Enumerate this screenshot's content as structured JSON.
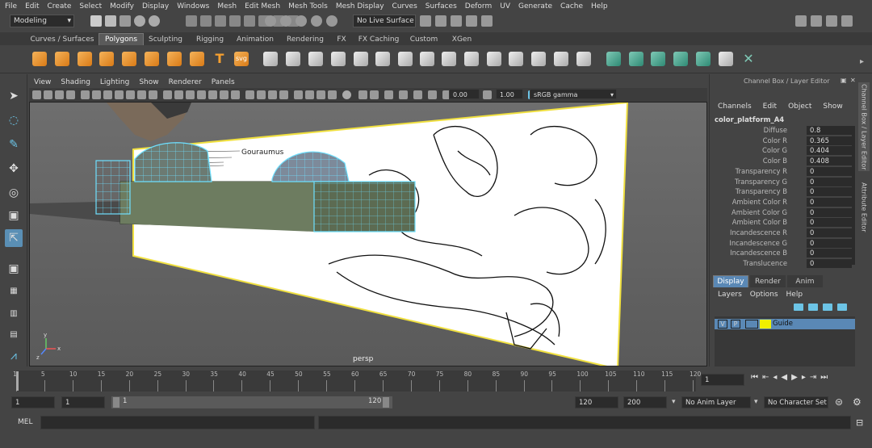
{
  "menubar": [
    "File",
    "Edit",
    "Create",
    "Select",
    "Modify",
    "Display",
    "Windows",
    "Mesh",
    "Edit Mesh",
    "Mesh Tools",
    "Mesh Display",
    "Curves",
    "Surfaces",
    "Deform",
    "UV",
    "Generate",
    "Cache",
    "Help"
  ],
  "status": {
    "mode": "Modeling",
    "live_surface": "No Live Surface"
  },
  "shelf_tabs": [
    "Curves / Surfaces",
    "Polygons",
    "Sculpting",
    "Rigging",
    "Animation",
    "Rendering",
    "FX",
    "FX Caching",
    "Custom",
    "XGen"
  ],
  "active_shelf_tab": "Polygons",
  "viewport": {
    "menu": [
      "View",
      "Shading",
      "Lighting",
      "Show",
      "Renderer",
      "Panels"
    ],
    "exposure": "0.00",
    "gamma": "1.00",
    "color_space": "sRGB gamma",
    "camera_label": "persp",
    "ref_image_text": "Gouraumus"
  },
  "channel_box": {
    "header": "Channel Box / Layer Editor",
    "menus": [
      "Channels",
      "Edit",
      "Object",
      "Show"
    ],
    "object_name": "color_platform_A4",
    "attributes": [
      {
        "name": "Diffuse",
        "value": "0.8"
      },
      {
        "name": "Color R",
        "value": "0.365"
      },
      {
        "name": "Color G",
        "value": "0.404"
      },
      {
        "name": "Color B",
        "value": "0.408"
      },
      {
        "name": "Transparency R",
        "value": "0"
      },
      {
        "name": "Transparency G",
        "value": "0"
      },
      {
        "name": "Transparency B",
        "value": "0"
      },
      {
        "name": "Ambient Color R",
        "value": "0"
      },
      {
        "name": "Ambient Color G",
        "value": "0"
      },
      {
        "name": "Ambient Color B",
        "value": "0"
      },
      {
        "name": "Incandescence R",
        "value": "0"
      },
      {
        "name": "Incandescence G",
        "value": "0"
      },
      {
        "name": "Incandescence B",
        "value": "0"
      },
      {
        "name": "Translucence",
        "value": "0"
      }
    ],
    "side_tabs": [
      "Channel Box / Layer Editor",
      "Attribute Editor"
    ]
  },
  "layer_editor": {
    "tabs": [
      "Display",
      "Render",
      "Anim"
    ],
    "active_tab": "Display",
    "menus": [
      "Layers",
      "Options",
      "Help"
    ],
    "layer": {
      "v": "V",
      "p": "P",
      "name": "Guide",
      "color": "#f0f000"
    }
  },
  "timeline": {
    "ticks": [
      "1",
      "5",
      "10",
      "15",
      "20",
      "25",
      "30",
      "35",
      "40",
      "45",
      "50",
      "55",
      "60",
      "65",
      "70",
      "75",
      "80",
      "85",
      "90",
      "95",
      "100",
      "105",
      "110",
      "115",
      "120"
    ],
    "current_frame": "1"
  },
  "range": {
    "start": "1",
    "start_inner": "1",
    "slider_start": "1",
    "slider_end": "120",
    "end_inner": "120",
    "end": "200",
    "anim_layer": "No Anim Layer",
    "char_set": "No Character Set"
  },
  "cmd": {
    "label": "MEL"
  }
}
